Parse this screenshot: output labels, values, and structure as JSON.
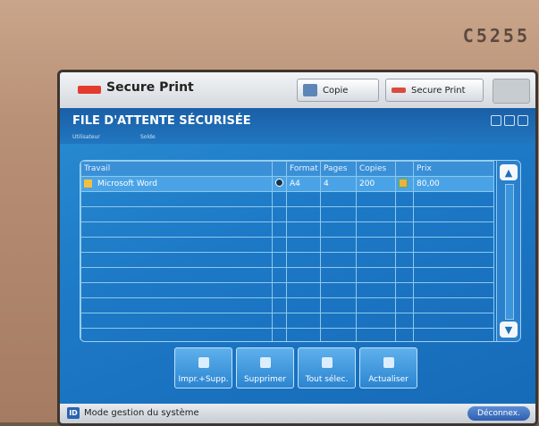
{
  "device": {
    "model": "C5255"
  },
  "header": {
    "app_title": "Secure Print",
    "tab_copy": "Copie",
    "tab_secure_print": "Secure Print"
  },
  "queue": {
    "title": "FILE D'ATTENTE SÉCURISÉE",
    "label_user": "Utilisateur",
    "label_solde": "Solde"
  },
  "table": {
    "columns": [
      "Travail",
      "",
      "Format",
      "Pages",
      "Copies",
      "",
      "Prix"
    ],
    "rows": [
      {
        "travail": "Microsoft Word",
        "format": "A4",
        "pages": "4",
        "copies": "200",
        "prix": "80,00"
      }
    ]
  },
  "actions": {
    "print_delete": "Impr.+Supp.",
    "delete": "Supprimer",
    "select_all": "Tout sélec.",
    "refresh": "Actualiser"
  },
  "footer": {
    "id_badge": "ID",
    "mode": "Mode gestion du système",
    "logout": "Déconnex."
  },
  "colors": {
    "screen_bg": "#1d79c6",
    "accent": "#2a63b0"
  }
}
